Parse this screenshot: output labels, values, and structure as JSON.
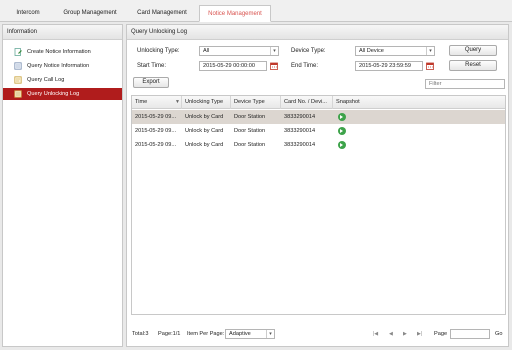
{
  "top_tabs": [
    {
      "label": "Intercom"
    },
    {
      "label": "Group Management"
    },
    {
      "label": "Card Management"
    },
    {
      "label": "Notice Management"
    }
  ],
  "sidebar": {
    "title": "Information",
    "items": [
      {
        "label": "Create Notice Information",
        "icon": "create-notice-icon"
      },
      {
        "label": "Query Notice Information",
        "icon": "query-notice-icon"
      },
      {
        "label": "Query Call Log",
        "icon": "call-log-icon"
      },
      {
        "label": "Query Unlocking Log",
        "icon": "unlocking-log-icon"
      }
    ]
  },
  "main": {
    "title": "Query Unlocking Log",
    "unlocking_type_label": "Unlocking Type:",
    "unlocking_type_value": "All",
    "device_type_label": "Device Type:",
    "device_type_value": "All Device",
    "start_time_label": "Start Time:",
    "start_time_value": "2015-05-29 00:00:00",
    "end_time_label": "End Time:",
    "end_time_value": "2015-05-29 23:59:59",
    "query_label": "Query",
    "reset_label": "Reset",
    "export_label": "Export",
    "filter_placeholder": "Filter"
  },
  "table": {
    "columns": [
      "Time",
      "Unlocking Type",
      "Device Type",
      "Card No. / Devi...",
      "Snapshot"
    ],
    "rows": [
      {
        "time": "2015-05-29 09...",
        "type": "Unlock by Card",
        "device": "Door Station",
        "card": "3833290014"
      },
      {
        "time": "2015-05-29 09...",
        "type": "Unlock by Card",
        "device": "Door Station",
        "card": "3833290014"
      },
      {
        "time": "2015-05-29 09...",
        "type": "Unlock by Card",
        "device": "Door Station",
        "card": "3833290014"
      }
    ]
  },
  "pager": {
    "total": "Total:3",
    "page": "Page:1/1",
    "per_page_label": "Item Per Page:",
    "per_page_value": "Adaptive",
    "page_label": "Page",
    "go_label": "Go"
  },
  "colors": {
    "accent": "#b01c1c",
    "snapshot": "#3da34a",
    "active_tab_text": "#d9534f"
  }
}
